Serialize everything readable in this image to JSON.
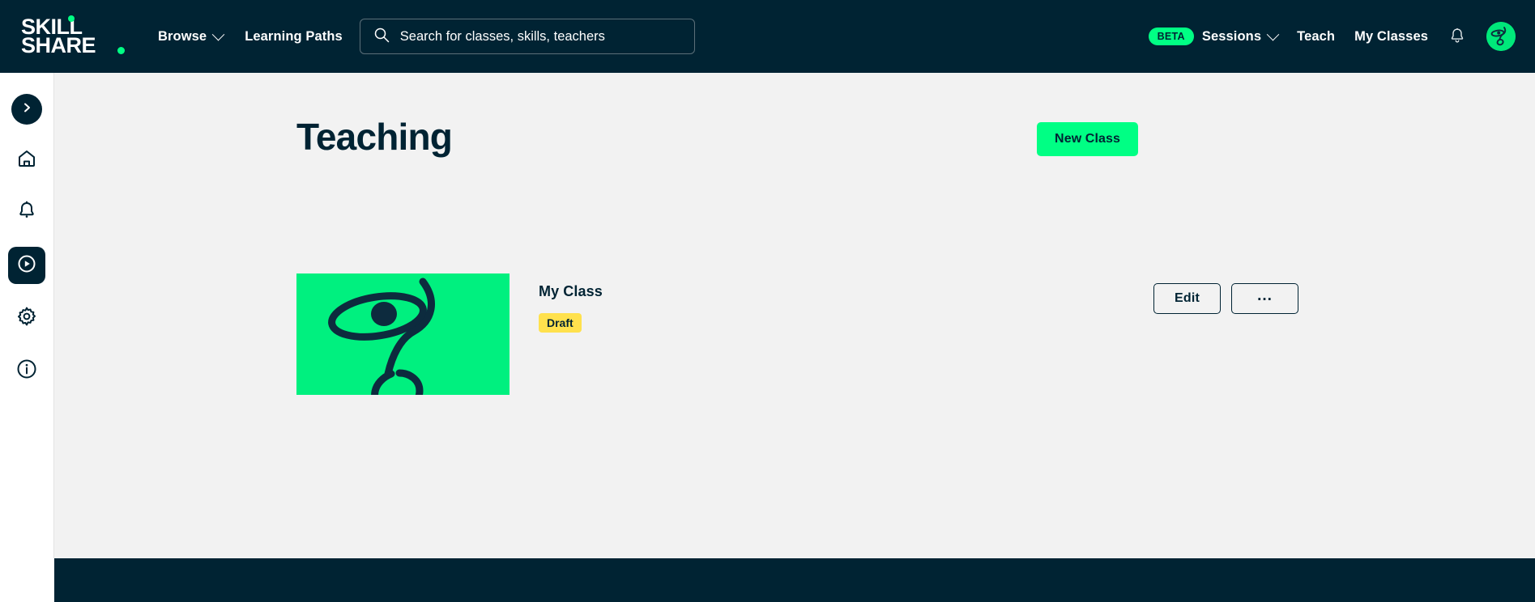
{
  "brand": {
    "logo_line1": "Skill",
    "logo_line2": "share",
    "accent_green": "#00ff84",
    "dark_navy": "#002333",
    "draft_yellow": "#ffe14d"
  },
  "header": {
    "nav_left": [
      {
        "label": "Browse",
        "icon": "chevron-down-icon",
        "has_chevron": true
      },
      {
        "label": "Learning Paths",
        "has_chevron": false
      }
    ],
    "search": {
      "placeholder": "Search for classes, skills, teachers",
      "value": "",
      "icon": "search-icon"
    },
    "nav_right": {
      "beta_badge": "BETA",
      "sessions_label": "Sessions",
      "teach_label": "Teach",
      "my_classes_label": "My Classes",
      "bell_icon": "bell-icon",
      "avatar_icon": "avatar"
    }
  },
  "sidebar": {
    "items": [
      {
        "icon": "chevron-right-icon",
        "name": "expand-sidebar",
        "active": false
      },
      {
        "icon": "home-icon",
        "name": "home",
        "active": false
      },
      {
        "icon": "bell-icon",
        "name": "notifications",
        "active": false
      },
      {
        "icon": "play-circle-icon",
        "name": "teaching",
        "active": true
      },
      {
        "icon": "gear-icon",
        "name": "settings",
        "active": false
      },
      {
        "icon": "info-icon",
        "name": "info",
        "active": false
      }
    ]
  },
  "main": {
    "page_title": "Teaching",
    "new_class_label": "New Class",
    "classes": [
      {
        "title": "My Class",
        "status": "Draft",
        "thumbnail_bg": "#00f07f",
        "edit_label": "Edit",
        "more_label": "..."
      }
    ]
  }
}
